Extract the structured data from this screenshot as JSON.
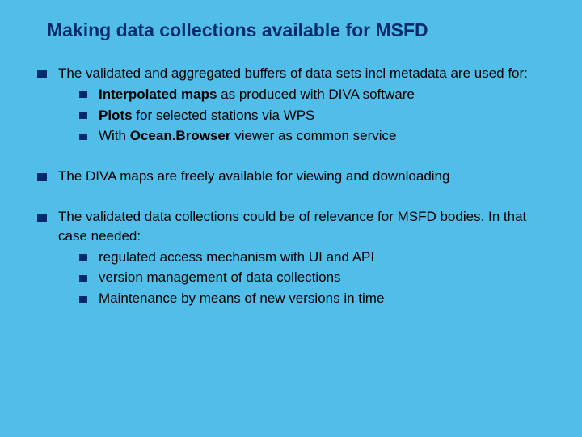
{
  "title": "Making data collections available for MSFD",
  "bullets": {
    "b0": {
      "lead": "The validated and aggregated buffers of data sets incl metadata are used for:",
      "sub": {
        "s0": {
          "strong": "Interpolated maps",
          "rest": " as produced with DIVA software"
        },
        "s1": {
          "strong": "Plots",
          "rest": " for selected stations via WPS"
        },
        "s2": {
          "pre": "With ",
          "strong": "Ocean.Browser",
          "rest": " viewer as common service"
        }
      }
    },
    "b1": {
      "lead": "The DIVA maps are freely available for viewing and downloading"
    },
    "b2": {
      "lead": "The validated data collections could be of relevance for MSFD bodies. In that case needed:",
      "sub": {
        "s0": {
          "text": "regulated access mechanism with UI and API"
        },
        "s1": {
          "text": "version management of data collections"
        },
        "s2": {
          "text": "Maintenance by means of new versions in time"
        }
      }
    }
  }
}
